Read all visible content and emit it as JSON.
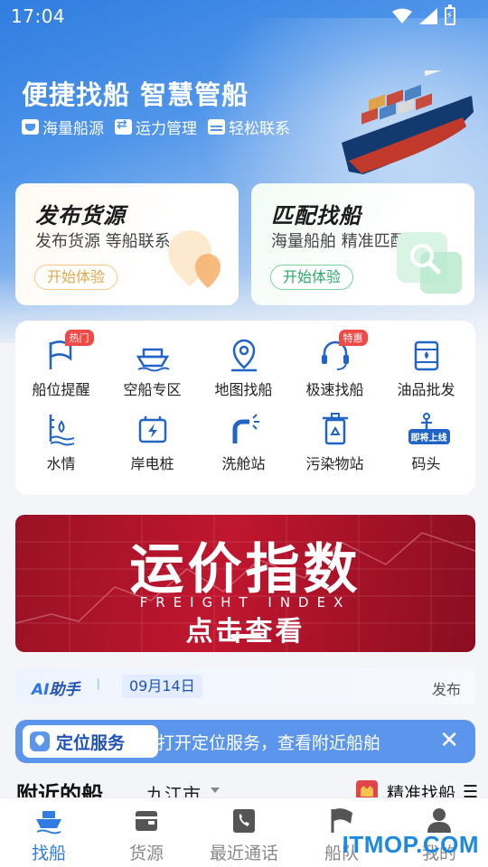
{
  "status": {
    "time": "17:04"
  },
  "hero": {
    "headline": "便捷找船 智慧管船",
    "tags": [
      "海量船源",
      "运力管理",
      "轻松联系"
    ]
  },
  "cards": [
    {
      "title": "发布货源",
      "subtitle": "发布货源  等船联系",
      "button": "开始体验"
    },
    {
      "title": "匹配找船",
      "subtitle": "海量船舶  精准匹配",
      "button": "开始体验"
    }
  ],
  "grid": {
    "items": [
      {
        "label": "船位提醒",
        "icon": "flag-alert-icon",
        "badge": "热门"
      },
      {
        "label": "空船专区",
        "icon": "empty-ship-icon"
      },
      {
        "label": "地图找船",
        "icon": "map-pin-icon"
      },
      {
        "label": "极速找船",
        "icon": "headset-icon",
        "badge": "特惠"
      },
      {
        "label": "油品批发",
        "icon": "oil-barrel-icon"
      },
      {
        "label": "水情",
        "icon": "water-level-icon"
      },
      {
        "label": "岸电桩",
        "icon": "charging-pile-icon"
      },
      {
        "label": "洗舱站",
        "icon": "wash-pipe-icon"
      },
      {
        "label": "污染物站",
        "icon": "recycle-bin-icon"
      },
      {
        "label": "码头",
        "icon": "anchor-icon",
        "badge": "即将上线"
      }
    ]
  },
  "banner": {
    "title": "运价指数",
    "subtitle": "FREIGHT INDEX",
    "cta": "点击查看"
  },
  "ai_bar": {
    "logo_ai": "AI",
    "logo_text": "助手",
    "date": "09月14日",
    "more": "发布"
  },
  "location": {
    "pill": "定位服务",
    "text": "打开定位服务，查看附近船舶"
  },
  "nearby": {
    "title": "附近的船",
    "city": "九江市",
    "precise": "精准找船"
  },
  "nav": {
    "items": [
      {
        "label": "找船",
        "icon": "ship-icon",
        "active": true
      },
      {
        "label": "货源",
        "icon": "wallet-icon"
      },
      {
        "label": "最近通话",
        "icon": "phone-icon"
      },
      {
        "label": "船队",
        "icon": "flag-icon"
      },
      {
        "label": "我的",
        "icon": "user-icon"
      }
    ]
  },
  "watermark": {
    "text": "ITMOP.COM"
  },
  "colors": {
    "primary": "#2f7de0",
    "badge": "#ef4a45",
    "banner": "#c0162f",
    "location_bar": "#5c96ec"
  }
}
